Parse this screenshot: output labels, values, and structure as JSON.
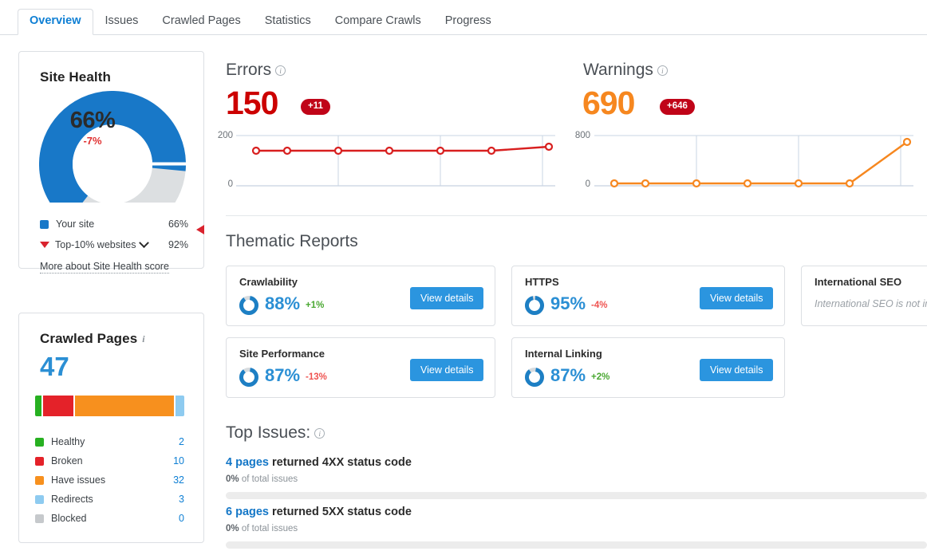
{
  "tabs": [
    {
      "label": "Overview",
      "active": true
    },
    {
      "label": "Issues",
      "active": false
    },
    {
      "label": "Crawled Pages",
      "active": false
    },
    {
      "label": "Statistics",
      "active": false
    },
    {
      "label": "Compare Crawls",
      "active": false
    },
    {
      "label": "Progress",
      "active": false
    }
  ],
  "site_health": {
    "title": "Site Health",
    "score": "66%",
    "delta": "-7%",
    "legend": [
      {
        "label": "Your site",
        "value": "66%",
        "color": "#1878c8",
        "marker": "square"
      },
      {
        "label": "Top-10% websites",
        "value": "92%",
        "color": "#d9232e",
        "marker": "triangle"
      }
    ],
    "more_link": "More about Site Health score"
  },
  "crawled_pages": {
    "title": "Crawled Pages",
    "total": "47",
    "legend": [
      {
        "label": "Healthy",
        "value": "2",
        "color": "#27b021"
      },
      {
        "label": "Broken",
        "value": "10",
        "color": "#e42229"
      },
      {
        "label": "Have issues",
        "value": "32",
        "color": "#f7901e"
      },
      {
        "label": "Redirects",
        "value": "3",
        "color": "#8ecbf0"
      },
      {
        "label": "Blocked",
        "value": "0",
        "color": "#c6c9cc"
      }
    ]
  },
  "errors": {
    "title": "Errors",
    "value": "150",
    "badge": "+11",
    "color": "#cc0000"
  },
  "warnings": {
    "title": "Warnings",
    "value": "690",
    "badge": "+646",
    "color": "#f6871f"
  },
  "thematic": {
    "heading": "Thematic Reports",
    "view_details": "View details",
    "cards": [
      {
        "title": "Crawlability",
        "pct": "88%",
        "delta": "+1%",
        "dir": "up"
      },
      {
        "title": "HTTPS",
        "pct": "95%",
        "delta": "-4%",
        "dir": "down"
      },
      {
        "title": "Site Performance",
        "pct": "87%",
        "delta": "-13%",
        "dir": "down"
      },
      {
        "title": "Internal Linking",
        "pct": "87%",
        "delta": "+2%",
        "dir": "up"
      },
      {
        "title": "International SEO",
        "note": "International SEO is not imp"
      }
    ]
  },
  "top_issues": {
    "heading": "Top Issues:",
    "items": [
      {
        "count": "4 pages",
        "text": " returned 4XX status code",
        "sub_pct": "0%",
        "sub_rest": " of total issues"
      },
      {
        "count": "6 pages",
        "text": " returned 5XX status code",
        "sub_pct": "0%",
        "sub_rest": " of total issues"
      }
    ]
  },
  "chart_data": [
    {
      "type": "line",
      "title": "Errors",
      "x": [
        1,
        2,
        3,
        4,
        5,
        6,
        7
      ],
      "values": [
        139,
        139,
        139,
        139,
        139,
        139,
        150
      ],
      "ylim": [
        0,
        200
      ],
      "yticks": [
        "0",
        "200"
      ],
      "color": "#d81f1f",
      "grid": true,
      "xlabel": "",
      "ylabel": ""
    },
    {
      "type": "line",
      "title": "Warnings",
      "x": [
        1,
        2,
        3,
        4,
        5,
        6,
        7
      ],
      "values": [
        44,
        44,
        44,
        44,
        44,
        44,
        690
      ],
      "ylim": [
        0,
        800
      ],
      "yticks": [
        "0",
        "800"
      ],
      "color": "#f6871f",
      "grid": true,
      "xlabel": "",
      "ylabel": ""
    }
  ]
}
